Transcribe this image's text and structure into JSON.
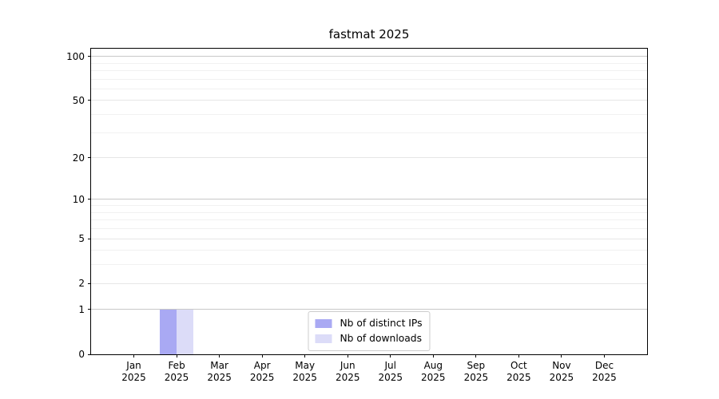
{
  "chart_data": {
    "type": "bar",
    "title": "fastmat 2025",
    "categories": [
      "Jan 2025",
      "Feb 2025",
      "Mar 2025",
      "Apr 2025",
      "May 2025",
      "Jun 2025",
      "Jul 2025",
      "Aug 2025",
      "Sep 2025",
      "Oct 2025",
      "Nov 2025",
      "Dec 2025"
    ],
    "x_tick_labels": [
      {
        "month": "Jan",
        "year": "2025"
      },
      {
        "month": "Feb",
        "year": "2025"
      },
      {
        "month": "Mar",
        "year": "2025"
      },
      {
        "month": "Apr",
        "year": "2025"
      },
      {
        "month": "May",
        "year": "2025"
      },
      {
        "month": "Jun",
        "year": "2025"
      },
      {
        "month": "Jul",
        "year": "2025"
      },
      {
        "month": "Aug",
        "year": "2025"
      },
      {
        "month": "Sep",
        "year": "2025"
      },
      {
        "month": "Oct",
        "year": "2025"
      },
      {
        "month": "Nov",
        "year": "2025"
      },
      {
        "month": "Dec",
        "year": "2025"
      }
    ],
    "series": [
      {
        "name": "Nb of distinct IPs",
        "color": "#a9a9f3",
        "values": [
          0,
          1,
          0,
          0,
          0,
          0,
          0,
          0,
          0,
          0,
          0,
          0
        ]
      },
      {
        "name": "Nb of downloads",
        "color": "#dcdcf8",
        "values": [
          0,
          1,
          0,
          0,
          0,
          0,
          0,
          0,
          0,
          0,
          0,
          0
        ]
      }
    ],
    "y_axis": {
      "scale": "log1p",
      "tick_values": [
        0,
        1,
        2,
        5,
        10,
        20,
        50,
        100
      ],
      "tick_labels": [
        "0",
        "1",
        "2",
        "5",
        "10",
        "20",
        "50",
        "100"
      ],
      "decade_gridlines": [
        1,
        10,
        100
      ],
      "mid_gridlines": [
        2,
        5,
        20,
        50
      ],
      "minor_gridlines": [
        3,
        4,
        6,
        7,
        8,
        9,
        30,
        40,
        60,
        70,
        80,
        90
      ],
      "ylim": [
        0,
        110
      ]
    },
    "legend": {
      "position": "lower center",
      "entries": [
        "Nb of distinct IPs",
        "Nb of downloads"
      ]
    },
    "grid": true
  },
  "style": {
    "background": "#ffffff",
    "spine_color": "#000000",
    "text_color": "#000000",
    "decade_grid_color": "#c8c8c8",
    "mid_grid_color": "#e6e6e6",
    "minor_grid_color": "#f1f1f1",
    "legend_border_color": "#cccccc",
    "bar_distinct_ips_color": "#a9a9f3",
    "bar_downloads_color": "#dcdcf8"
  }
}
